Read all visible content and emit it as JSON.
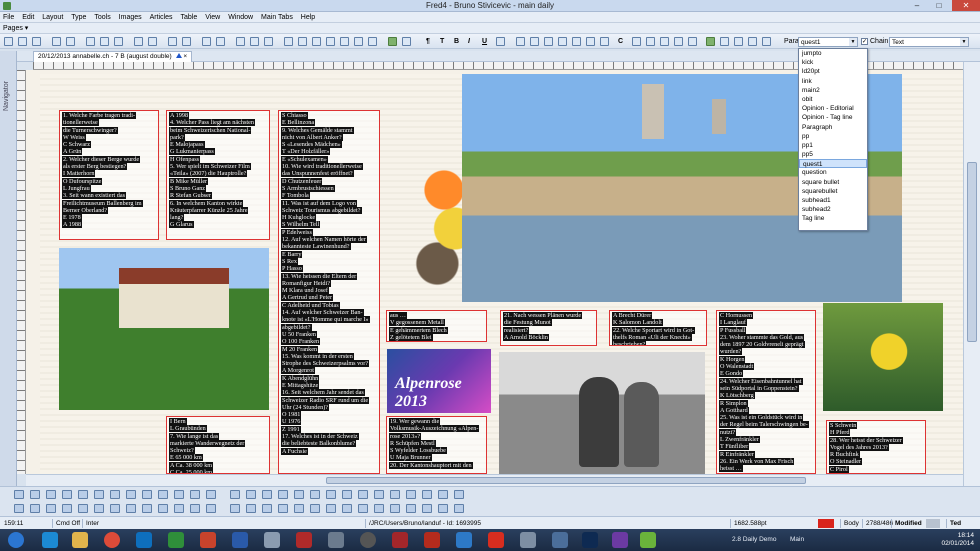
{
  "window": {
    "title": "Fred4 - Bruno Stivicevic - main daily",
    "minimize": "–",
    "maximize": "□",
    "close": "✕"
  },
  "menu": [
    "File",
    "Edit",
    "Layout",
    "Type",
    "Tools",
    "Images",
    "Articles",
    "Table",
    "View",
    "Window",
    "Main Tabs",
    "Help"
  ],
  "pages_label": "Pages",
  "toolbar": {
    "para_label": "Para",
    "chain_label": "Chain",
    "text_combo": "Text"
  },
  "nav_label": "Navigator",
  "doc_tab": {
    "label": "20/12/2013 annabelle.ch - 7 B (august double)",
    "close": "×"
  },
  "dropdown": {
    "options": [
      "jumpto",
      "kick",
      "ld20pt",
      "link",
      "main2",
      "obit",
      "Opinion - Editorial",
      "Opinion - Tag line",
      "Paragraph",
      "pp",
      "pp1",
      "pp5",
      "quest1",
      "question",
      "square bullet",
      "squarebullet",
      "subhead1",
      "subhead2",
      "Tag line"
    ],
    "selected": "quest1"
  },
  "columns": {
    "c1": [
      "1. Welche Farbe tragen tradi-",
      "tionellerweise",
      "die Turnerschwinger?",
      "W Weiss",
      "C Schwarz",
      "A Grün",
      "2. Welcher dieser Berge wurde",
      "als erster Berg bestiegen?",
      "I Matterhorn",
      "O Dufourspitze",
      "L Jungfrau",
      "3. Seit wann existiert das",
      "Freilichtmuseum Ballenberg im",
      "Berner Oberland?",
      "E 1978",
      "A 1988"
    ],
    "c2": [
      "A 1998",
      "4. Welcher Pass liegt am nächsten",
      "beim Schweizerischen National-",
      "park?",
      "E Malojapass",
      "G Lukmanierpass",
      "H Ofenpass",
      "5. Wer spielt im Schweizer Film",
      "«Teila» (2007) die Hauptrolle?",
      "B Mike Müller",
      "S Bruno Ganz",
      "R Stefan Gubser",
      "6. In welchem Kanton wirkte",
      "Kräuterpfarrer Künzle 25 Jahre",
      "lang?",
      "G Glarus"
    ],
    "c2b": [
      "I Bern",
      "L Graubünden",
      "7. Wie lange ist das",
      "markierte Wanderwegnetz der",
      "Schweiz?",
      "E 65 000 km",
      "A Ca. 38 000 km",
      "C Ca. 25 000 km"
    ],
    "c3": [
      "S Chiasso",
      "E Bellinzona",
      "9. Welches Gemälde stammt",
      "nicht von Albert Anker?",
      "S «Lesendes Mädchen»",
      "T «Der Holzfäller»",
      "E «Schulexamen»",
      "10. Wie wird traditionellerweise",
      "das Unspunnenfest eröffnet?",
      "D Chutzenfeuer",
      "S Armbrustschiessen",
      "F Tombola",
      "11. Was ist auf dem Logo von",
      "Schweiz Tourismus abgebildet?",
      "H Kuhglocke",
      "S Wilhelm Tell",
      "P Edelweiss",
      "12. Auf welchen Namen hörte der",
      "bekannteste Lawinenhund?",
      "E Barry",
      "S Rex",
      "P Hasso",
      "13. Wie heissen die Eltern der",
      "Romanfigur Heidi?",
      "M Klara und Josef",
      "A Gertrud und Peter",
      "C Adelheid und Tobias",
      "14. Auf welcher Schweizer Ban-",
      "knote ist «L'Homme qui marche I»",
      "abgebildet?",
      "U 50 Franken",
      "O 100 Franken",
      "M 20 Franken",
      "15. Was kommt in der ersten",
      "Strophe des Schweizerpsalms vor?",
      "A Morgenrot",
      "K Abendglühn",
      "E Mittagshitze",
      "16. Seit welchem Jahr sendet das",
      "Schweizer Radio SRF rund um die",
      "Uhr (24 Stunden)?",
      "O 1981",
      "U 1976",
      "Z 1991",
      "17. Welches ist in der Schweiz",
      "die beliebteste Balkonblume?",
      "A Fuchsie"
    ],
    "c4a": [
      "aus …",
      "V gegossenem Metall",
      "E gehämmertem Blech",
      "Z gelötetem Blei"
    ],
    "c4b": [
      "21. Nach wessen Plänen wurde",
      "die Festung Munot",
      "realisiert?",
      "A Arnold Böcklin"
    ],
    "c5": [
      "A Brecht Dürer",
      "K Salomon Landolt",
      "22. Welche Sportart wird in Got-",
      "thelfs Roman «Uli der Knecht»",
      "beschrieben?"
    ],
    "c6": [
      "19. Wer gewann die",
      "Volksmusik-Auszeichnung «Alpen-",
      "rose 2013»?",
      "R Schüpfen Mestl",
      "S Wyfelder Lossbuebe",
      "U Maja Brunner",
      "20. Der Kantonshauptort mit den"
    ],
    "c7": [
      "C Hornussen",
      "I Langlauf",
      "P Fussball",
      "23. Woher stammte das Gold, aus",
      "dem 1897 20 Goldvreneli geprägt",
      "wurden?",
      "K Horgen",
      "O Walenstadt",
      "E Gondo",
      "24. Welcher Eisenbahntunnel hat",
      "sein Südportal in Goppenstein?",
      "K Lötschberg",
      "R Simplon",
      "A Gotthard",
      "25. Was ist ein Goldstück wird in",
      "der Regel beim Talerschwingen be-",
      "nutzt?",
      "L Zwenfränkler",
      "T Fünfliber",
      "R Einfränkler",
      "26. Ein Werk von Max Frisch",
      "heisst …"
    ],
    "c8": [
      "S Schwein",
      "H Pferd",
      "28. Wer heisst der Schweizer",
      "Vogel des Jahres 2013?",
      "R Buchfink",
      "O Steinadler",
      "C Pirol"
    ]
  },
  "alpenrose_text": "Alpenrose 2013",
  "status": {
    "pos": "159:11",
    "cmd": "Cmd Off",
    "mode": "Inter",
    "path": "/JRC/Users/Bruno/landuf - Id: 1693995",
    "size": "1682.588pt",
    "body": "Body",
    "count": "2788/486",
    "modified": "Modified",
    "user": "Ted"
  },
  "taskbar": {
    "demo": "2.8 Daily Demo",
    "main": "Main",
    "time": "18:14",
    "date": "02/01/2014"
  }
}
